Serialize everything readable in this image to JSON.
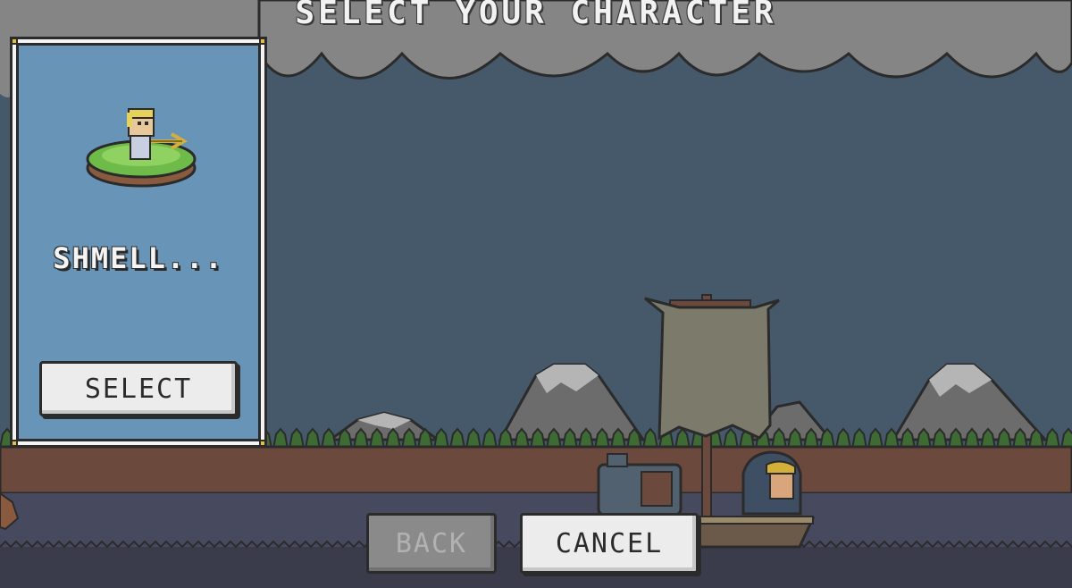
{
  "screen": {
    "title": "SELECT YOUR CHARACTER"
  },
  "character_card": {
    "name": "SHMELL...",
    "portrait_icon": "hero-on-floating-island-icon",
    "select_label": "SELECT"
  },
  "footer": {
    "back_label": "BACK",
    "back_enabled": false,
    "cancel_label": "CANCEL"
  },
  "scene": {
    "sky_color": "#45596b",
    "cloud_color": "#858585",
    "mountain_color": "#6c6c6c",
    "treeline_color": "#3e6b34",
    "dirt_color": "#6b4a3d",
    "water_color": "#474a5e",
    "card_color": "#6895b7"
  }
}
